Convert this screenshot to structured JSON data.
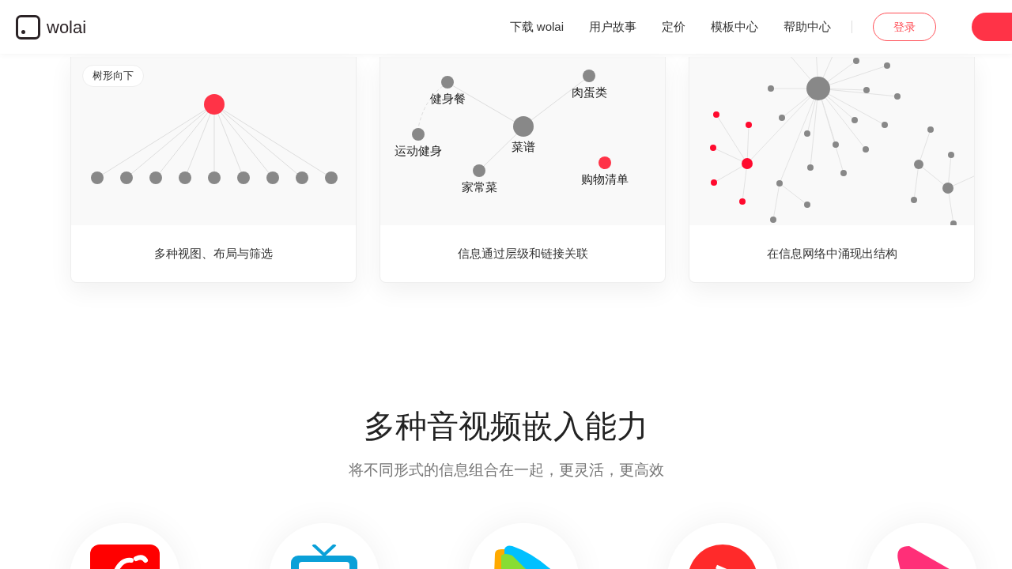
{
  "header": {
    "brand": "wolai",
    "nav": [
      "下载 wolai",
      "用户故事",
      "定价",
      "模板中心",
      "帮助中心"
    ],
    "login": "登录"
  },
  "cards": [
    {
      "kind": "tree",
      "badge": "树形向下",
      "caption": "多种视图、布局与筛选"
    },
    {
      "kind": "mindmap",
      "caption": "信息通过层级和链接关联",
      "nodes": [
        {
          "label": "健身餐",
          "color": "#888888"
        },
        {
          "label": "运动健身",
          "color": "#888888"
        },
        {
          "label": "菜谱",
          "color": "#888888"
        },
        {
          "label": "肉蛋类",
          "color": "#888888"
        },
        {
          "label": "家常菜",
          "color": "#888888"
        },
        {
          "label": "购物清单",
          "color": "#ff3347"
        }
      ]
    },
    {
      "kind": "network",
      "caption": "在信息网络中涌现出结构"
    }
  ],
  "section": {
    "title": "多种音视频嵌入能力",
    "subtitle": "将不同形式的信息组合在一起，更灵活，更高效"
  }
}
